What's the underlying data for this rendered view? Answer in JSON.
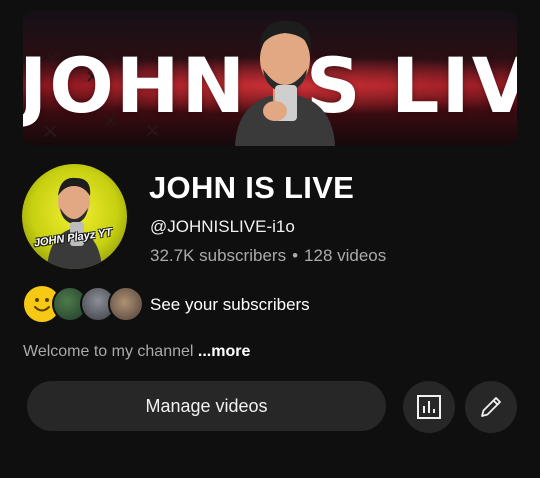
{
  "banner": {
    "text": "JOHN IS LIVE"
  },
  "avatar": {
    "label": "JOHN Playz YT"
  },
  "channel": {
    "name": "JOHN IS LIVE",
    "handle": "@JOHNISLIVE-i1o",
    "subscribers": "32.7K subscribers",
    "separator": "•",
    "videos": "128 videos"
  },
  "subscribers_link": {
    "label": "See your subscribers"
  },
  "description": {
    "text": "Welcome to my channel",
    "more": "...more"
  },
  "actions": {
    "manage_label": "Manage videos",
    "analytics_icon": "bar-chart-icon",
    "edit_icon": "pencil-icon"
  },
  "colors": {
    "background": "#0f0f0f",
    "button": "#272727",
    "secondary_text": "#aaaaaa",
    "banner_red": "#8c1620",
    "avatar_yellow": "#f2f030"
  }
}
